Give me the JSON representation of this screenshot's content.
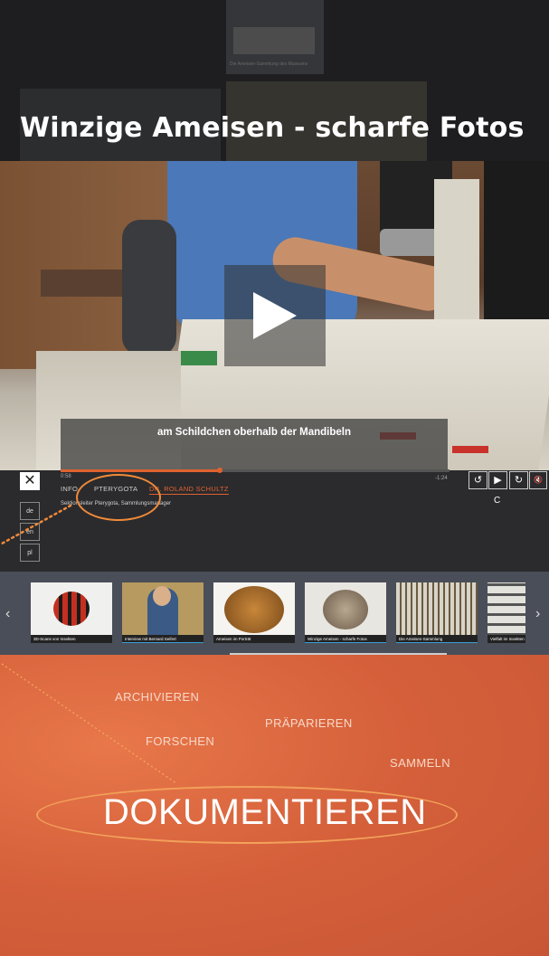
{
  "page": {
    "title": "Winzige Ameisen - scharfe Fotos",
    "background_thumb_caption": "Die Ameisen-Sammlung des Museums"
  },
  "video": {
    "subtitle": "am Schildchen oberhalb der Mandibeln",
    "progress": 0.41,
    "time_elapsed": "0:58",
    "time_remaining": "-1:24"
  },
  "panel": {
    "close_label": "✕",
    "tabs": [
      {
        "label": "INFO"
      },
      {
        "label": "PTERYGOTA"
      },
      {
        "label": "DR. ROLAND SCHULTZ"
      }
    ],
    "description": "Sektionsleiter Pterygota, Sammlungsmanager",
    "languages": [
      "de",
      "en",
      "pl"
    ],
    "controls": {
      "replay": "↺",
      "play": "▶",
      "forward": "↻",
      "mute": "🔇",
      "cc": "C"
    }
  },
  "thumbnails": [
    {
      "caption": "3D-Scans von Insekten"
    },
    {
      "caption": "Interview mit Bernard Seifert"
    },
    {
      "caption": "Ameisen im Porträt"
    },
    {
      "caption": "Winzige Ameisen - scharfe Fotos"
    },
    {
      "caption": "Die Ameisen-Sammlung"
    },
    {
      "caption": "Vielfalt im Insekten"
    }
  ],
  "words": {
    "archivieren": "ARCHIVIEREN",
    "praeparieren": "PRÄPARIEREN",
    "forschen": "FORSCHEN",
    "sammeln": "SAMMELN",
    "dokumentieren": "DOKUMENTIEREN"
  },
  "colors": {
    "accent": "#e0622f",
    "annotation": "#f08a3a"
  }
}
